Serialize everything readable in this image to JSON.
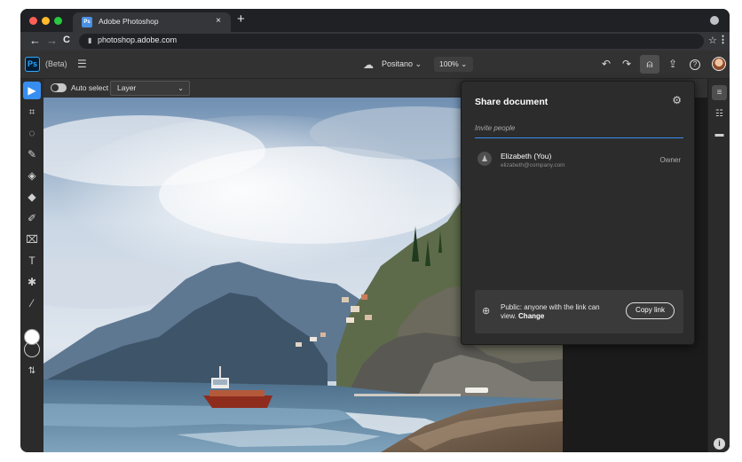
{
  "browser": {
    "tab_title": "Adobe Photoshop",
    "tab_favicon": "Ps",
    "tab_close": "×",
    "new_tab": "+",
    "url": "photoshop.adobe.com",
    "nav": {
      "back": "←",
      "forward": "→",
      "reload": "C"
    },
    "star": "☆",
    "menu": "⋮"
  },
  "app": {
    "logo": "Ps",
    "beta": "(Beta)",
    "menu_icon": "☰",
    "document_name": "Positano ⌄",
    "zoom": "100% ⌄",
    "icons": {
      "undo": "↶",
      "redo": "↷",
      "share": "⍝",
      "export": "⇪",
      "help": "?",
      "cloud": "☁"
    }
  },
  "options": {
    "auto_select_label": "Auto select",
    "layer_select_value": "Layer",
    "chevron": "⌄"
  },
  "tools": [
    {
      "name": "move-tool",
      "glyph": "▶",
      "active": true
    },
    {
      "name": "artboard-tool",
      "glyph": "⌗"
    },
    {
      "name": "quick-select-tool",
      "glyph": "◌"
    },
    {
      "name": "brush-tool",
      "glyph": "✎"
    },
    {
      "name": "eraser-tool",
      "glyph": "◈"
    },
    {
      "name": "paint-bucket-tool",
      "glyph": "◆"
    },
    {
      "name": "healing-tool",
      "glyph": "✐"
    },
    {
      "name": "crop-tool",
      "glyph": "⌧"
    },
    {
      "name": "type-tool",
      "glyph": "T"
    },
    {
      "name": "content-aware-tool",
      "glyph": "✱"
    },
    {
      "name": "eyedropper-tool",
      "glyph": "⁄"
    }
  ],
  "swap_colors": "⇅",
  "share_dialog": {
    "title": "Share document",
    "gear": "⚙",
    "invite_placeholder": "Invite people",
    "person": {
      "name": "Elizabeth (You)",
      "email": "elizabeth@company.com",
      "role": "Owner",
      "icon": "♟"
    },
    "public_text": "Public: anyone with the link can view.",
    "change_label": "Change",
    "copy_link_label": "Copy link",
    "globe": "⊕"
  },
  "right_rail": {
    "layers": "≡",
    "adjust": "☷",
    "comments": "▬",
    "info": "i"
  },
  "colors": {
    "accent_blue": "#378ef0",
    "panel": "#2c2c2c",
    "app_bg": "#323232",
    "tab_favicon": "#4a90e2"
  }
}
